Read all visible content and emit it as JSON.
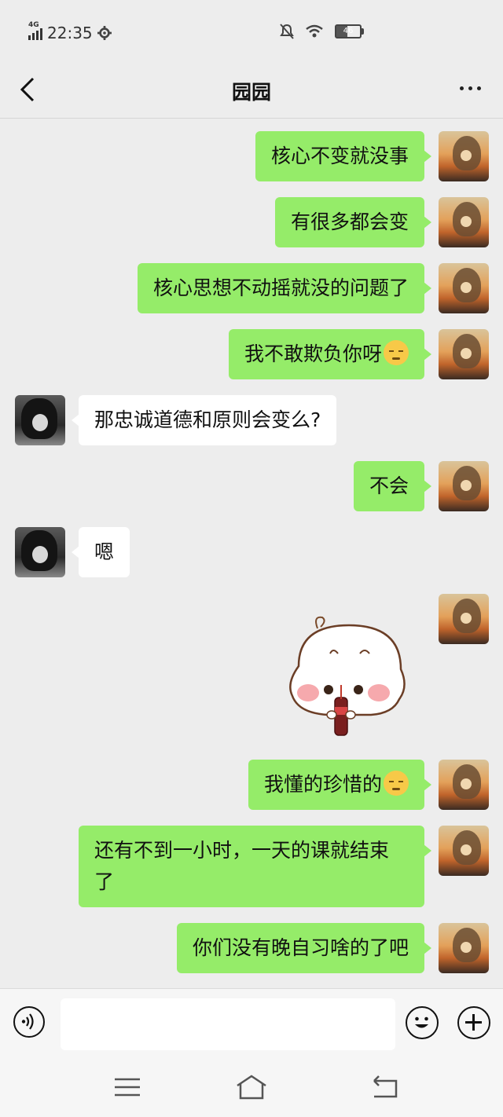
{
  "status_bar": {
    "network": "4G",
    "time": "22:35",
    "battery": "46"
  },
  "header": {
    "title": "园园"
  },
  "messages": [
    {
      "sender": "me",
      "text": "核心不变就没事"
    },
    {
      "sender": "me",
      "text": "有很多都会变"
    },
    {
      "sender": "me",
      "text": "核心思想不动摇就没的问题了"
    },
    {
      "sender": "me",
      "text": "我不敢欺负你呀",
      "emoji": "pouting-face-emoji"
    },
    {
      "sender": "other",
      "text": "那忠诚道德和原则会变么?"
    },
    {
      "sender": "me",
      "text": "不会"
    },
    {
      "sender": "other",
      "text": "嗯"
    },
    {
      "sender": "me",
      "type": "sticker",
      "sticker": "bun-drinking-cola-sticker"
    },
    {
      "sender": "me",
      "text": "我懂的珍惜的",
      "emoji": "sweat-face-emoji"
    },
    {
      "sender": "me",
      "text_line1": "还有不到一小时，一天的课就结束",
      "text_line2": "了"
    },
    {
      "sender": "me",
      "text": "你们没有晚自习啥的了吧"
    }
  ],
  "input_bar": {
    "placeholder": ""
  },
  "icons": {
    "back": "chevron-left-icon",
    "more": "more-dots-icon",
    "voice": "voice-icon",
    "emoji": "emoji-icon",
    "plus": "plus-icon",
    "nav_menu": "menu-icon",
    "nav_home": "home-icon",
    "nav_back": "back-icon"
  },
  "colors": {
    "my_bubble": "#95ec69",
    "other_bubble": "#ffffff",
    "background": "#ededed"
  }
}
